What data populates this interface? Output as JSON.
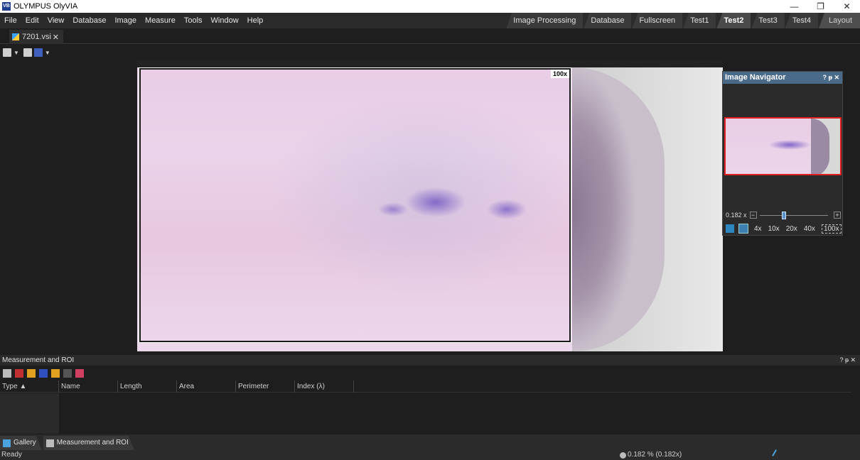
{
  "titlebar": {
    "title": "OLYMPUS OlyVIA",
    "app_icon_text": "VB",
    "minimize": "—",
    "maximize": "❐",
    "close": "✕"
  },
  "menu": [
    "File",
    "Edit",
    "View",
    "Database",
    "Image",
    "Measure",
    "Tools",
    "Window",
    "Help"
  ],
  "workspace_tabs": {
    "items": [
      "Image Processing",
      "Database",
      "Fullscreen",
      "Test1",
      "Test2",
      "Test3",
      "Test4"
    ],
    "active": "Test2",
    "layout_label": "Layout"
  },
  "document": {
    "tab_name": "7201.vsi",
    "close": "✕"
  },
  "viewer": {
    "roi_magnification": "100x"
  },
  "navigator": {
    "title": "Image Navigator",
    "controls": "? ᵽ ✕",
    "zoom_value": "0.182 x",
    "minus": "−",
    "plus": "+",
    "magnifications": [
      "4x",
      "10x",
      "20x",
      "40x",
      "100x"
    ],
    "active_magnification": "100x"
  },
  "measurement_panel": {
    "title": "Measurement and ROI",
    "controls": "? ᵽ ✕",
    "columns": [
      "Type",
      "Name",
      "Length",
      "Area",
      "Perimeter",
      "Index (λ)"
    ]
  },
  "bottom_tabs": [
    "Gallery",
    "Measurement and ROI"
  ],
  "status": {
    "text": "Ready",
    "zoom": "0.182 % (0.182x)"
  },
  "colors": {
    "accent": "#4a6a8a",
    "navigator_frame": "#e02020",
    "background": "#1e1e1e"
  }
}
